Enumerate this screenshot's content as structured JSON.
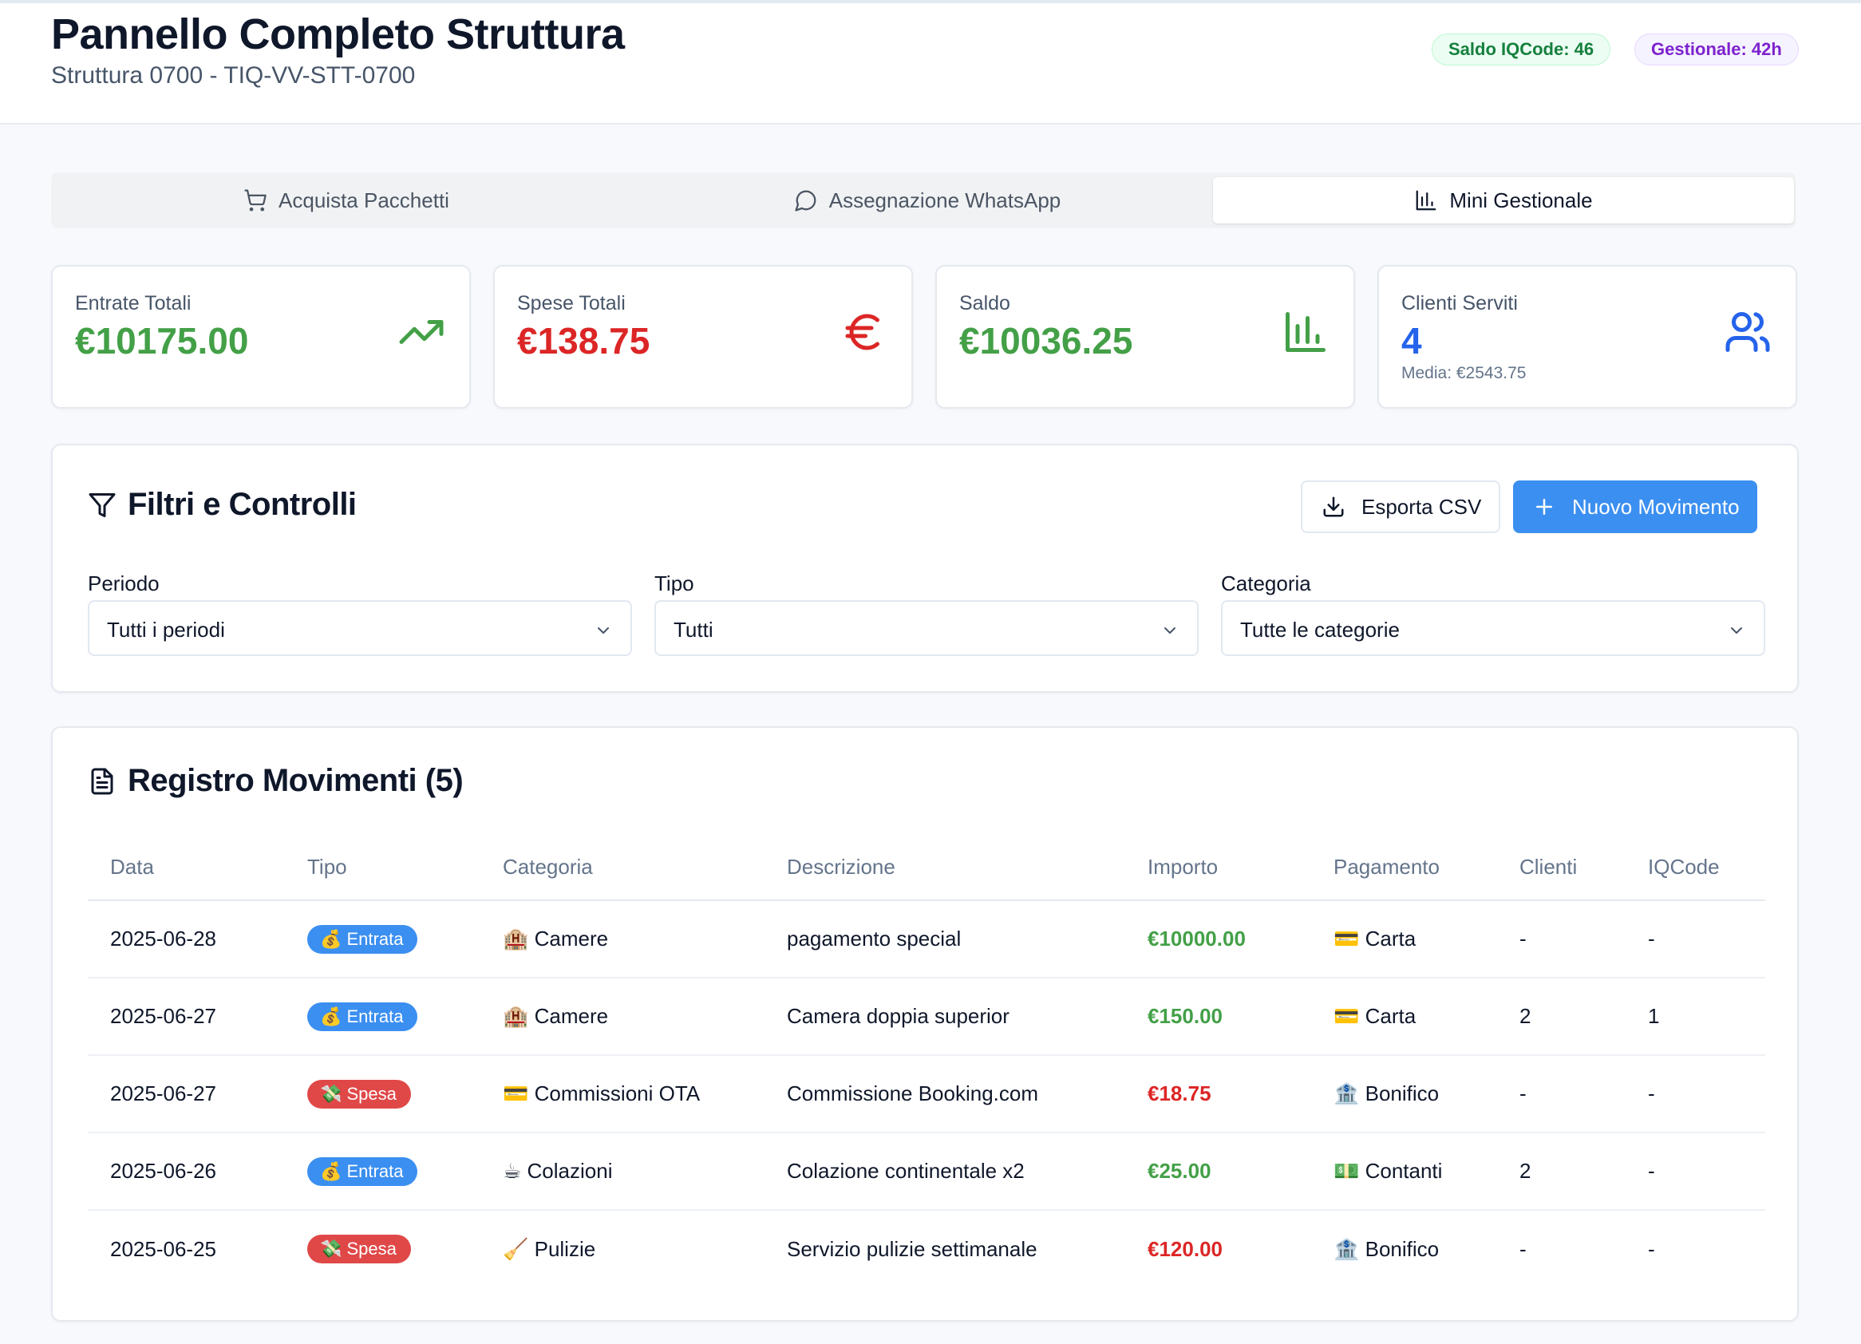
{
  "header": {
    "title": "Pannello Completo Struttura",
    "subtitle": "Struttura 0700 - TIQ-VV-STT-0700",
    "badges": {
      "saldo": "Saldo IQCode: 46",
      "gestionale": "Gestionale: 42h"
    }
  },
  "tabs": [
    {
      "label": "Acquista Pacchetti",
      "icon": "cart-icon",
      "active": false
    },
    {
      "label": "Assegnazione WhatsApp",
      "icon": "chat-icon",
      "active": false
    },
    {
      "label": "Mini Gestionale",
      "icon": "bar-chart-icon",
      "active": true
    }
  ],
  "stats": {
    "entrate": {
      "label": "Entrate Totali",
      "value": "€10175.00",
      "icon": "trending-up-icon"
    },
    "spese": {
      "label": "Spese Totali",
      "value": "€138.75",
      "icon": "euro-icon"
    },
    "saldo": {
      "label": "Saldo",
      "value": "€10036.25",
      "icon": "bar-chart-icon"
    },
    "clienti": {
      "label": "Clienti Serviti",
      "value": "4",
      "sub": "Media: €2543.75",
      "icon": "users-icon"
    }
  },
  "filters": {
    "title": "Filtri e Controlli",
    "export_label": "Esporta CSV",
    "new_label": "Nuovo Movimento",
    "periodo": {
      "label": "Periodo",
      "value": "Tutti i periodi"
    },
    "tipo": {
      "label": "Tipo",
      "value": "Tutti"
    },
    "categoria": {
      "label": "Categoria",
      "value": "Tutte le categorie"
    }
  },
  "registry": {
    "title": "Registro Movimenti (5)",
    "columns": [
      "Data",
      "Tipo",
      "Categoria",
      "Descrizione",
      "Importo",
      "Pagamento",
      "Clienti",
      "IQCode"
    ],
    "rows": [
      {
        "data": "2025-06-28",
        "tipo": "💰 Entrata",
        "kind": "in",
        "categoria": "🏨 Camere",
        "descrizione": "pagamento special",
        "importo": "€10000.00",
        "pagamento": "💳 Carta",
        "clienti": "-",
        "iqcode": "-"
      },
      {
        "data": "2025-06-27",
        "tipo": "💰 Entrata",
        "kind": "in",
        "categoria": "🏨 Camere",
        "descrizione": "Camera doppia superior",
        "importo": "€150.00",
        "pagamento": "💳 Carta",
        "clienti": "2",
        "iqcode": "1"
      },
      {
        "data": "2025-06-27",
        "tipo": "💸 Spesa",
        "kind": "out",
        "categoria": "💳 Commissioni OTA",
        "descrizione": "Commissione Booking.com",
        "importo": "€18.75",
        "pagamento": "🏦 Bonifico",
        "clienti": "-",
        "iqcode": "-"
      },
      {
        "data": "2025-06-26",
        "tipo": "💰 Entrata",
        "kind": "in",
        "categoria": "☕ Colazioni",
        "descrizione": "Colazione continentale x2",
        "importo": "€25.00",
        "pagamento": "💵 Contanti",
        "clienti": "2",
        "iqcode": "-"
      },
      {
        "data": "2025-06-25",
        "tipo": "💸 Spesa",
        "kind": "out",
        "categoria": "🧹 Pulizie",
        "descrizione": "Servizio pulizie settimanale",
        "importo": "€120.00",
        "pagamento": "🏦 Bonifico",
        "clienti": "-",
        "iqcode": "-"
      }
    ]
  },
  "colors": {
    "income": "#43a047",
    "expense": "#dc2626",
    "accent": "#3b8ff0",
    "clients": "#2563eb"
  }
}
